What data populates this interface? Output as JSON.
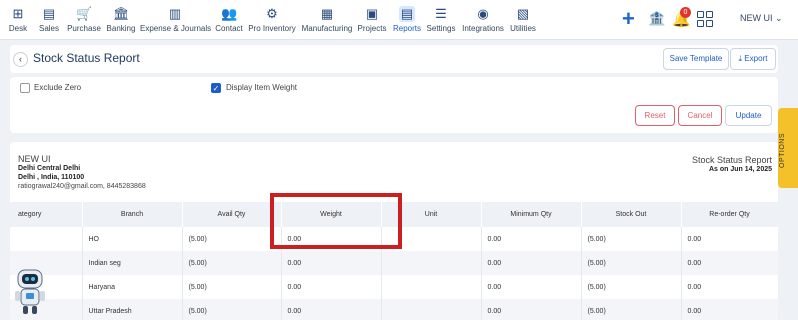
{
  "nav": {
    "items": [
      {
        "label": "Desk",
        "icon": "desk-icon",
        "glyph": "⊞"
      },
      {
        "label": "Sales",
        "icon": "sales-icon",
        "glyph": "▤"
      },
      {
        "label": "Purchase",
        "icon": "purchase-icon",
        "glyph": "🛒"
      },
      {
        "label": "Banking",
        "icon": "banking-icon",
        "glyph": "🏛"
      },
      {
        "label": "Expense & Journals",
        "icon": "journal-icon",
        "glyph": "▥"
      },
      {
        "label": "Contact",
        "icon": "contact-icon",
        "glyph": "👥"
      },
      {
        "label": "Pro Inventory",
        "icon": "inventory-icon",
        "glyph": "⚙"
      },
      {
        "label": "Manufacturing",
        "icon": "manufacturing-icon",
        "glyph": "▦"
      },
      {
        "label": "Projects",
        "icon": "projects-icon",
        "glyph": "▣"
      },
      {
        "label": "Reports",
        "icon": "reports-icon",
        "glyph": "▤",
        "active": true
      },
      {
        "label": "Settings",
        "icon": "settings-icon",
        "glyph": "☰"
      },
      {
        "label": "Integrations",
        "icon": "integrations-icon",
        "glyph": "◉"
      },
      {
        "label": "Utilities",
        "icon": "utilities-icon",
        "glyph": "▧"
      }
    ],
    "notification_count": "0",
    "company": "NEW UI ⌄"
  },
  "header": {
    "title": "Stock Status Report",
    "save_template": "Save Template",
    "export": "⤓ Export"
  },
  "filters": {
    "exclude_zero": "Exclude Zero",
    "display_item_weight": "Display Item Weight",
    "reset": "Reset",
    "cancel": "Cancel",
    "update": "Update",
    "options": "OPTIONS"
  },
  "report": {
    "company": "NEW UI",
    "address1": "Delhi Central Delhi",
    "address2": "Delhi , India, 110100",
    "contact": "ratiograwal240@gmail.com, 8445283868",
    "title": "Stock Status Report",
    "date": "As on Jun 14, 2025",
    "columns": [
      "ategory",
      "Branch",
      "Avail Qty",
      "Weight",
      "Unit",
      "Minimum Qty",
      "Stock Out",
      "Re-order Qty"
    ],
    "rows": [
      [
        "",
        "HO",
        "(5.00)",
        "0.00",
        "",
        "0.00",
        "(5.00)",
        "0.00"
      ],
      [
        "",
        "Indian seg",
        "(5.00)",
        "0.00",
        "",
        "0.00",
        "(5.00)",
        "0.00"
      ],
      [
        "",
        "Haryana",
        "(5.00)",
        "0.00",
        "",
        "0.00",
        "(5.00)",
        "0.00"
      ],
      [
        "",
        "Uttar Pradesh",
        "(5.00)",
        "0.00",
        "",
        "0.00",
        "(5.00)",
        "0.00"
      ]
    ]
  },
  "colors": {
    "accent": "#1f5cc9",
    "danger": "#e0606a",
    "highlight": "#cc1f1f",
    "options_tab": "#f4c12b"
  }
}
